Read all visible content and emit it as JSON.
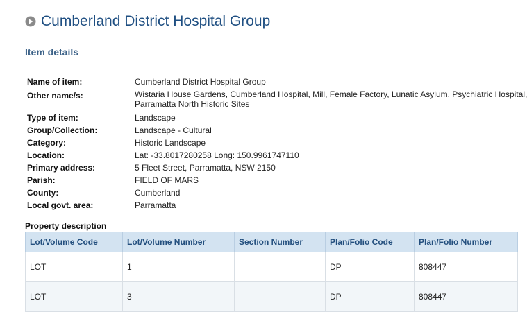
{
  "header": {
    "title": "Cumberland District Hospital Group",
    "icon": "circle-play-icon"
  },
  "section": {
    "heading": "Item details"
  },
  "details": {
    "name": {
      "label": "Name of item:",
      "value": "Cumberland District Hospital Group"
    },
    "other_names": {
      "label": "Other name/s:",
      "line1": "Wistaria House Gardens, Cumberland Hospital, Mill, Female Factory, Lunatic Asylum, Psychiatric Hospital,",
      "line2": "Parramatta North Historic Sites"
    },
    "type": {
      "label": "Type of item:",
      "value": "Landscape"
    },
    "group": {
      "label": "Group/Collection:",
      "value": "Landscape - Cultural"
    },
    "category": {
      "label": "Category:",
      "value": "Historic Landscape"
    },
    "location": {
      "label": "Location:",
      "value": "Lat: -33.8017280258 Long: 150.9961747110"
    },
    "address": {
      "label": "Primary address:",
      "value": "5 Fleet Street, Parramatta, NSW 2150"
    },
    "parish": {
      "label": "Parish:",
      "value": "FIELD OF MARS"
    },
    "county": {
      "label": "County:",
      "value": "Cumberland"
    },
    "lga": {
      "label": "Local govt. area:",
      "value": "Parramatta"
    }
  },
  "property": {
    "label": "Property description",
    "headers": [
      "Lot/Volume Code",
      "Lot/Volume Number",
      "Section Number",
      "Plan/Folio Code",
      "Plan/Folio Number"
    ],
    "rows": [
      [
        "LOT",
        "1",
        "",
        "DP",
        "808447"
      ],
      [
        "LOT",
        "3",
        "",
        "DP",
        "808447"
      ]
    ]
  },
  "colors": {
    "title": "#1f4f82",
    "heading": "#3c6288",
    "table_header_bg": "#d3e3f1"
  }
}
